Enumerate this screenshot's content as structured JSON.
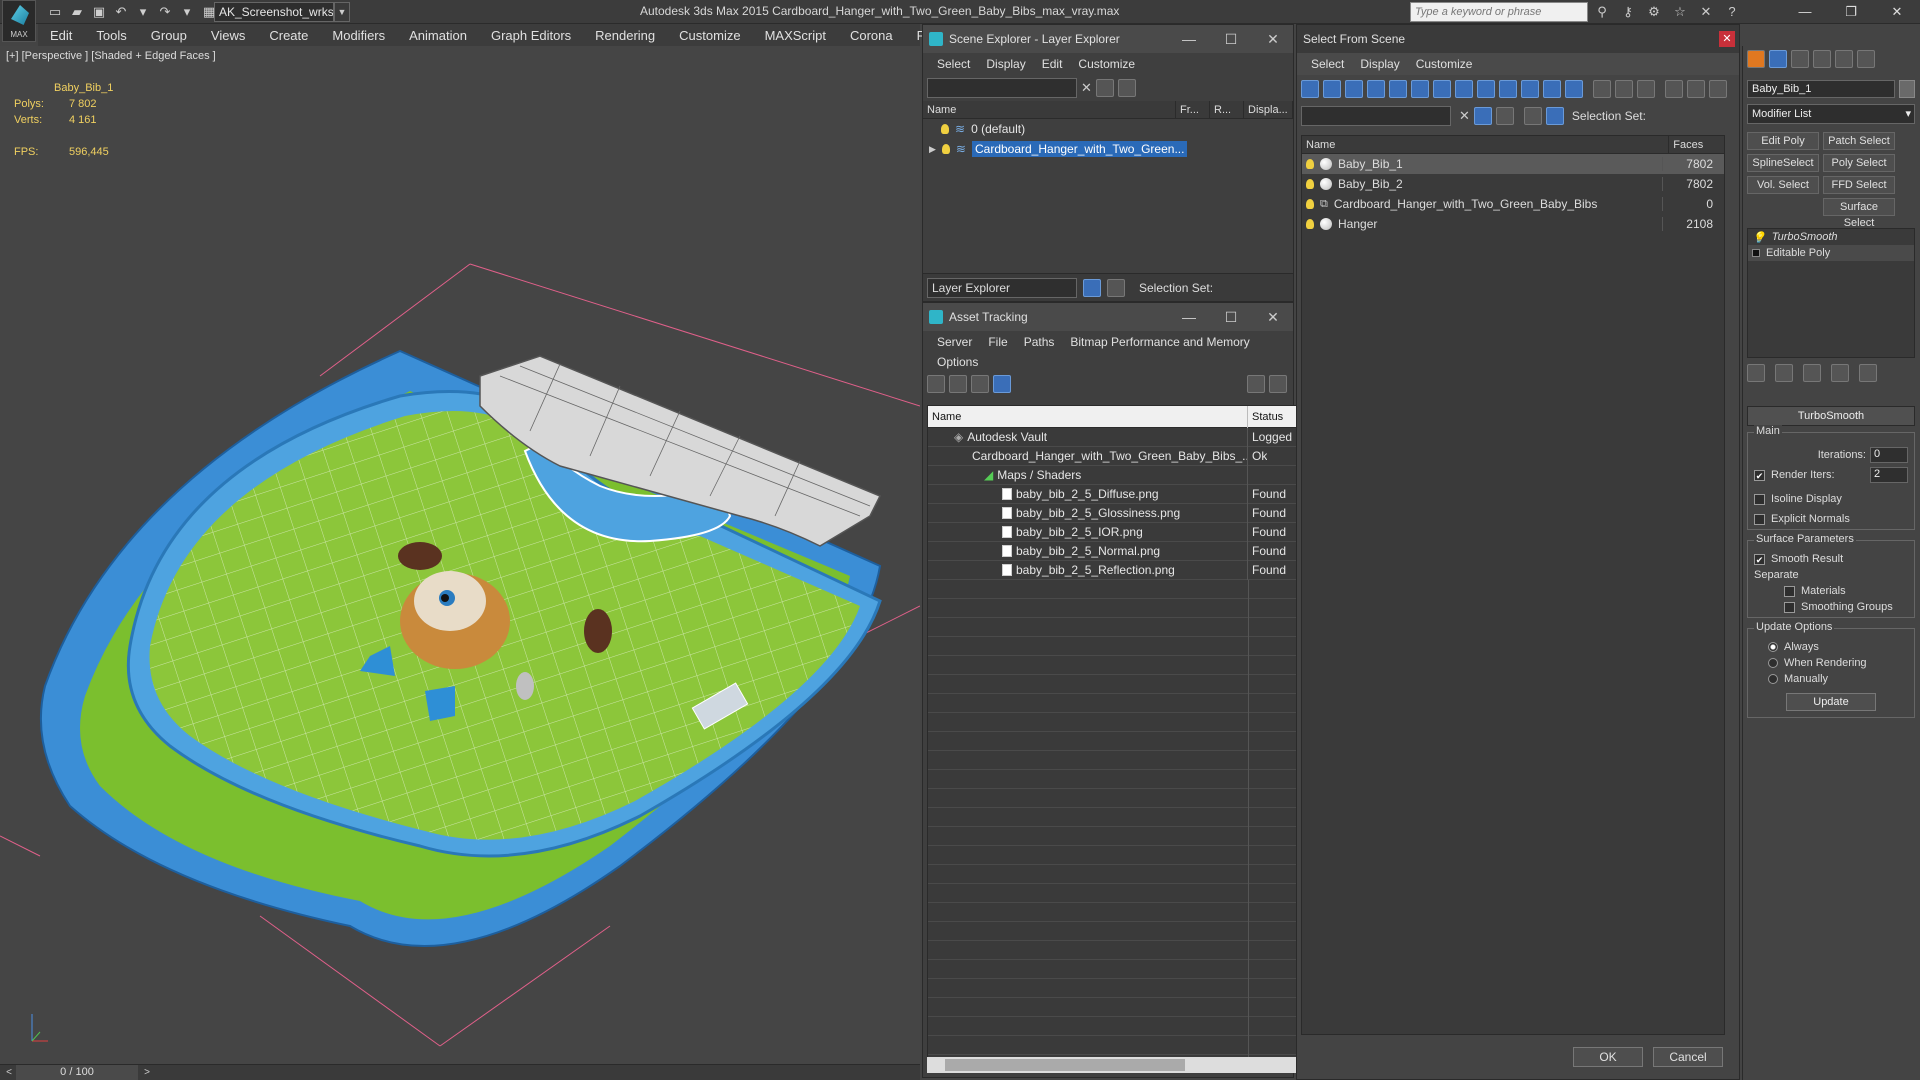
{
  "app": {
    "title": "Autodesk 3ds Max  2015     Cardboard_Hanger_with_Two_Green_Baby_Bibs_max_vray.max",
    "logo_text": "MAX",
    "workspace": "AK_Screenshot_wrksp",
    "search_placeholder": "Type a keyword or phrase",
    "menu": [
      "Edit",
      "Tools",
      "Group",
      "Views",
      "Create",
      "Modifiers",
      "Animation",
      "Graph Editors",
      "Rendering",
      "Customize",
      "MAXScript",
      "Corona",
      "Project Man"
    ]
  },
  "viewport": {
    "label": "[+] [Perspective ] [Shaded + Edged Faces ]",
    "object_name": "Baby_Bib_1",
    "polys_label": "Polys:",
    "polys": "7 802",
    "verts_label": "Verts:",
    "verts": "4 161",
    "fps_label": "FPS:",
    "fps": "596,445",
    "frame": "0 / 100"
  },
  "scene_explorer": {
    "title": "Scene Explorer - Layer Explorer",
    "menu": [
      "Select",
      "Display",
      "Edit",
      "Customize"
    ],
    "columns": [
      "Name",
      "Fr...",
      "R...",
      "Displa..."
    ],
    "rows": [
      "0 (default)",
      "Cardboard_Hanger_with_Two_Green..."
    ],
    "footer_dropdown": "Layer Explorer",
    "selection_set": "Selection Set:"
  },
  "asset_tracking": {
    "title": "Asset Tracking",
    "menu": [
      "Server",
      "File",
      "Paths",
      "Bitmap Performance and Memory"
    ],
    "menu2": "Options",
    "columns": [
      "Name",
      "Status"
    ],
    "rows": [
      {
        "name": "Autodesk Vault",
        "status": "Logged"
      },
      {
        "name": "Cardboard_Hanger_with_Two_Green_Baby_Bibs_...",
        "status": "Ok"
      },
      {
        "name": "Maps / Shaders",
        "status": ""
      },
      {
        "name": "baby_bib_2_5_Diffuse.png",
        "status": "Found"
      },
      {
        "name": "baby_bib_2_5_Glossiness.png",
        "status": "Found"
      },
      {
        "name": "baby_bib_2_5_IOR.png",
        "status": "Found"
      },
      {
        "name": "baby_bib_2_5_Normal.png",
        "status": "Found"
      },
      {
        "name": "baby_bib_2_5_Reflection.png",
        "status": "Found"
      }
    ]
  },
  "select_from_scene": {
    "title": "Select From Scene",
    "menu": [
      "Select",
      "Display",
      "Customize"
    ],
    "selection_set": "Selection Set:",
    "columns": [
      "Name",
      "Faces"
    ],
    "rows": [
      {
        "name": "Baby_Bib_1",
        "faces": "7802"
      },
      {
        "name": "Baby_Bib_2",
        "faces": "7802"
      },
      {
        "name": "Cardboard_Hanger_with_Two_Green_Baby_Bibs",
        "faces": "0"
      },
      {
        "name": "Hanger",
        "faces": "2108"
      }
    ],
    "ok": "OK",
    "cancel": "Cancel"
  },
  "command_panel": {
    "object_name": "Baby_Bib_1",
    "modifier_list": "Modifier List",
    "buttons": [
      "Edit Poly",
      "Patch Select",
      "SplineSelect",
      "Poly Select",
      "Vol. Select",
      "FFD Select",
      "Surface Select"
    ],
    "stack": [
      "TurboSmooth",
      "Editable Poly"
    ],
    "rollout_title": "TurboSmooth",
    "main_group": "Main",
    "iterations_label": "Iterations:",
    "iterations": "0",
    "render_iters_label": "Render Iters:",
    "render_iters": "2",
    "isoline": "Isoline Display",
    "explicit_normals": "Explicit Normals",
    "surface_params": "Surface Parameters",
    "smooth_result": "Smooth Result",
    "separate": "Separate",
    "materials": "Materials",
    "smoothing_groups": "Smoothing Groups",
    "update_options": "Update Options",
    "always": "Always",
    "when_rendering": "When Rendering",
    "manually": "Manually",
    "update": "Update"
  }
}
